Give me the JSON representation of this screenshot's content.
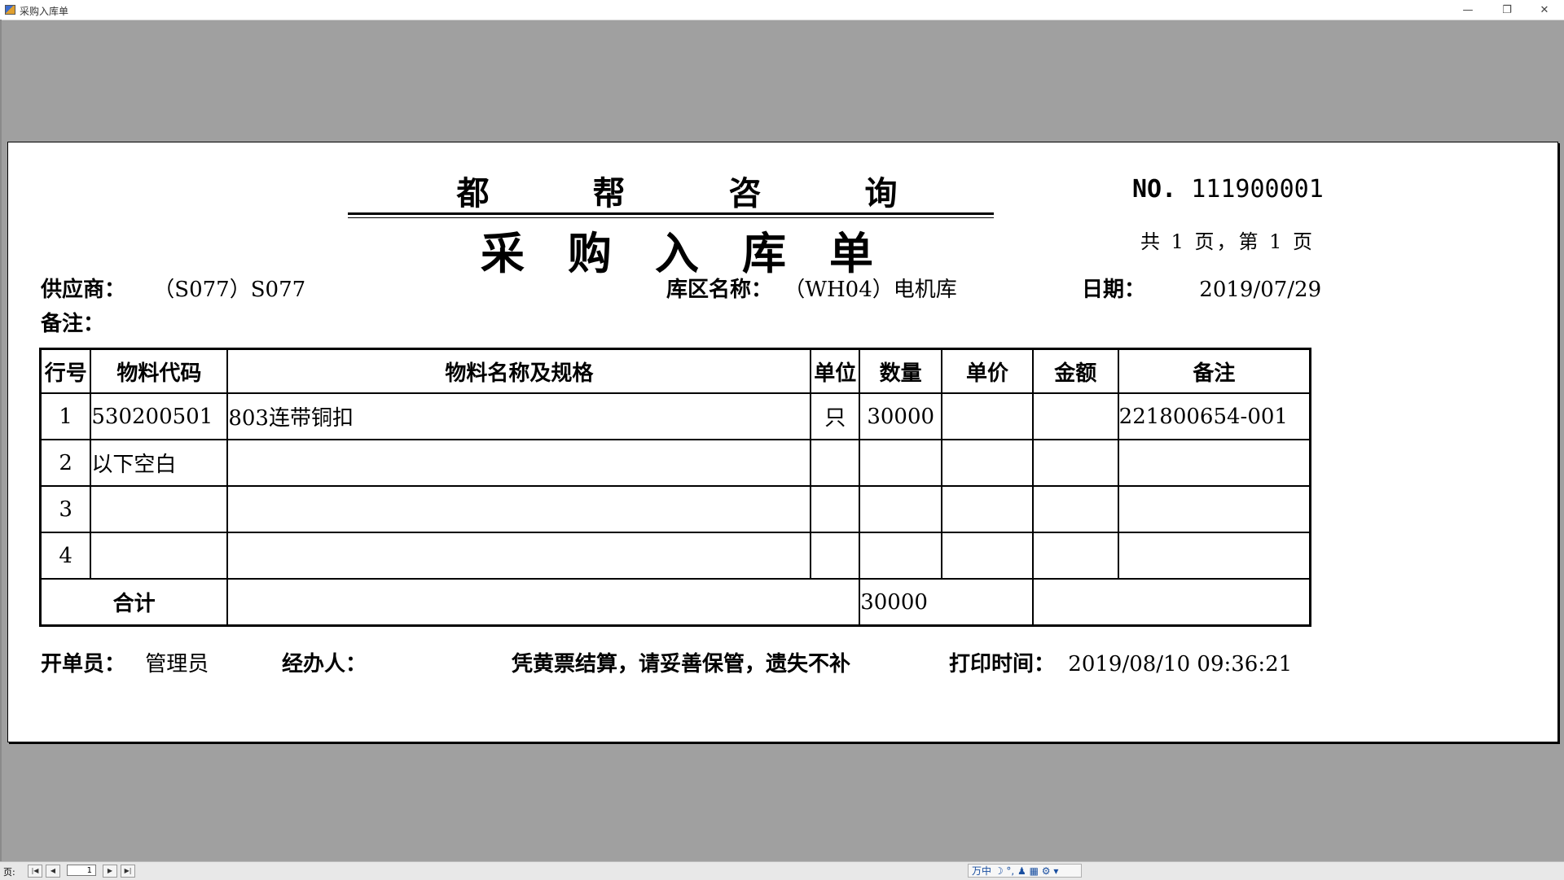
{
  "window": {
    "title": "采购入库单",
    "min_glyph": "—",
    "restore_glyph": "❐",
    "close_glyph": "✕"
  },
  "document": {
    "company_chars": [
      "都",
      "帮",
      "咨",
      "询"
    ],
    "title_chars": [
      "采",
      "购",
      "入",
      "库",
      "单"
    ],
    "no_label": "NO.",
    "no_value": "111900001",
    "page_info": "共 1 页，第 1 页",
    "supplier_label": "供应商：",
    "supplier_value": "（S077）S077",
    "warehouse_label": "库区名称：",
    "warehouse_value": "（WH04）电机库",
    "date_label": "日期：",
    "date_value": "2019/07/29",
    "remark_label": "备注：",
    "table": {
      "headers": [
        "行号",
        "物料代码",
        "物料名称及规格",
        "单位",
        "数量",
        "单价",
        "金额",
        "备注"
      ],
      "rows": [
        [
          "1",
          "530200501",
          "803连带铜扣",
          "只",
          "30000",
          "",
          "",
          "221800654-001"
        ],
        [
          "2",
          "以下空白",
          "",
          "",
          "",
          "",
          "",
          ""
        ],
        [
          "3",
          "",
          "",
          "",
          "",
          "",
          "",
          ""
        ],
        [
          "4",
          "",
          "",
          "",
          "",
          "",
          "",
          ""
        ]
      ],
      "total_label": "合计",
      "total_qty": "30000"
    },
    "creator_label": "开单员：",
    "creator_value": "管理员",
    "handler_label": "经办人：",
    "notice": "凭黄票结算，请妥善保管，遗失不补",
    "print_time_label": "打印时间：",
    "print_time_value": "2019/08/10 09:36:21"
  },
  "statusbar": {
    "page_label": "页:",
    "page_value": "1",
    "first_glyph": "|◀",
    "prev_glyph": "◀",
    "next_glyph": "▶",
    "last_glyph": "▶|",
    "ime_text": "万中 ☽ °, ♟ ▦ ⚙ ▾"
  }
}
